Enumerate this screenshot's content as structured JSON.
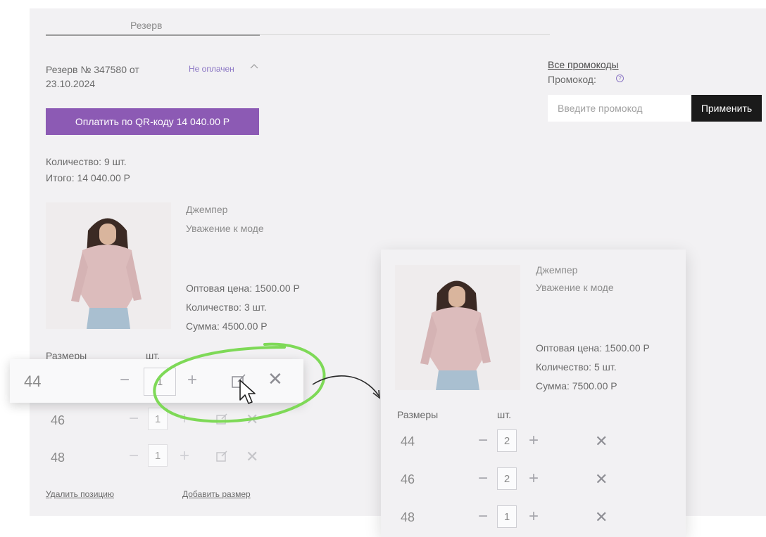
{
  "tab": {
    "label": "Резерв"
  },
  "order": {
    "title": "Резерв № 347580 от 23.10.2024",
    "status": "Не оплачен"
  },
  "pay_button": {
    "label": "Оплатить по QR-коду 14 040.00 Р"
  },
  "summary": {
    "quantity": "Количество: 9 шт.",
    "total": "Итого: 14 040.00 Р"
  },
  "promo": {
    "all_link": "Все промокоды",
    "label": "Промокод:",
    "help": "?",
    "placeholder": "Введите промокод",
    "apply_label": "Применить"
  },
  "product": {
    "name": "Джемпер",
    "brand": "Уважение к моде",
    "price": "Оптовая цена: 1500.00 Р",
    "quantity": "Количество: 3 шт.",
    "sum": "Сумма: 4500.00 Р"
  },
  "sizes_table": {
    "header_size": "Размеры",
    "header_qty": "шт.",
    "rows": [
      {
        "size": "44",
        "qty": "1"
      },
      {
        "size": "46",
        "qty": "1"
      },
      {
        "size": "48",
        "qty": "1"
      }
    ]
  },
  "links": {
    "delete": "Удалить позицию",
    "add_size": "Добавить размер"
  },
  "result_card": {
    "name": "Джемпер",
    "brand": "Уважение к моде",
    "price": "Оптовая цена: 1500.00 Р",
    "quantity": "Количество: 5 шт.",
    "sum": "Сумма: 7500.00 Р",
    "header_size": "Размеры",
    "header_qty": "шт.",
    "rows": [
      {
        "size": "44",
        "qty": "2"
      },
      {
        "size": "46",
        "qty": "2"
      },
      {
        "size": "48",
        "qty": "1"
      }
    ]
  },
  "colors": {
    "accent": "#8c5ab4",
    "status": "#8b76c4",
    "highlight": "#7ed957"
  },
  "icons": {
    "collapse": "chevron-up-icon",
    "edit": "edit-icon",
    "remove": "close-icon",
    "cursor": "cursor-icon",
    "arrow": "arrow-icon"
  }
}
